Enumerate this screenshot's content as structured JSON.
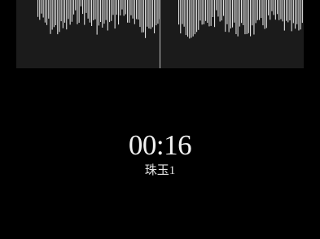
{
  "recording": {
    "elapsed": "00:16",
    "name": "珠玉1"
  },
  "colors": {
    "background": "#000000",
    "panel": "#1b1b1b",
    "wave": "#e0e0e0",
    "playhead": "#bdbdbd",
    "text": "#f2f2f2"
  }
}
